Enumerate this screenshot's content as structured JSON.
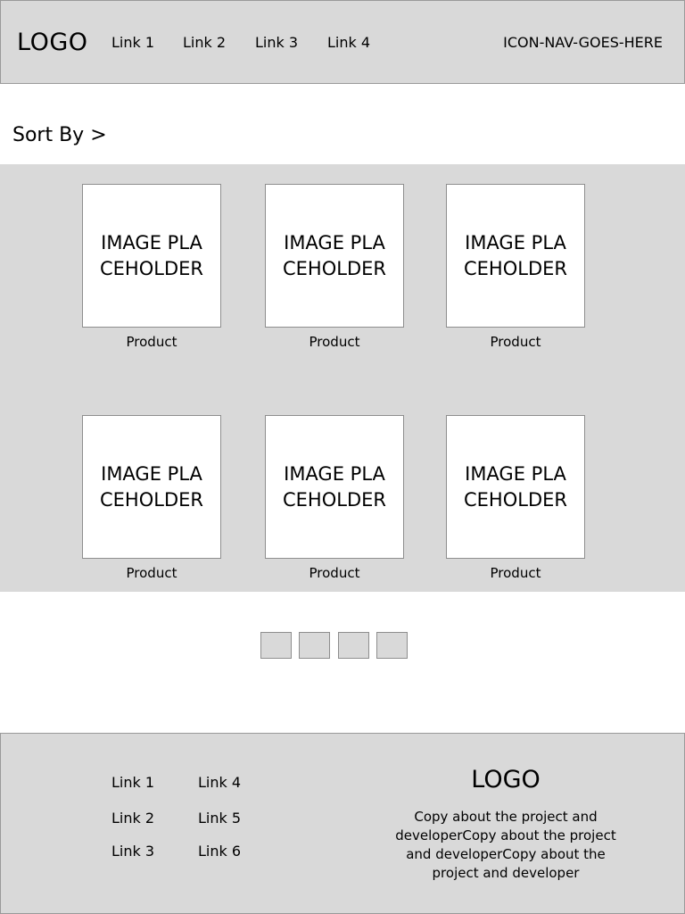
{
  "header": {
    "logo": "LOGO",
    "links": [
      "Link 1",
      "Link 2",
      "Link 3",
      "Link 4"
    ],
    "icon_nav": "ICON-NAV-GOES-HERE"
  },
  "sort": {
    "label": "Sort By >"
  },
  "products": [
    {
      "image_text": "IMAGE PLACEHOLDER",
      "label": "Product"
    },
    {
      "image_text": "IMAGE PLACEHOLDER",
      "label": "Product"
    },
    {
      "image_text": "IMAGE PLACEHOLDER",
      "label": "Product"
    },
    {
      "image_text": "IMAGE PLACEHOLDER",
      "label": "Product"
    },
    {
      "image_text": "IMAGE PLACEHOLDER",
      "label": "Product"
    },
    {
      "image_text": "IMAGE PLACEHOLDER",
      "label": "Product"
    }
  ],
  "footer": {
    "links_col1": [
      "Link 1",
      "Link 2",
      "Link 3"
    ],
    "links_col2": [
      "Link 4",
      "Link 5",
      "Link 6"
    ],
    "logo": "LOGO",
    "copy": "Copy about the project and developerCopy about the project and developerCopy about the project and developer"
  }
}
